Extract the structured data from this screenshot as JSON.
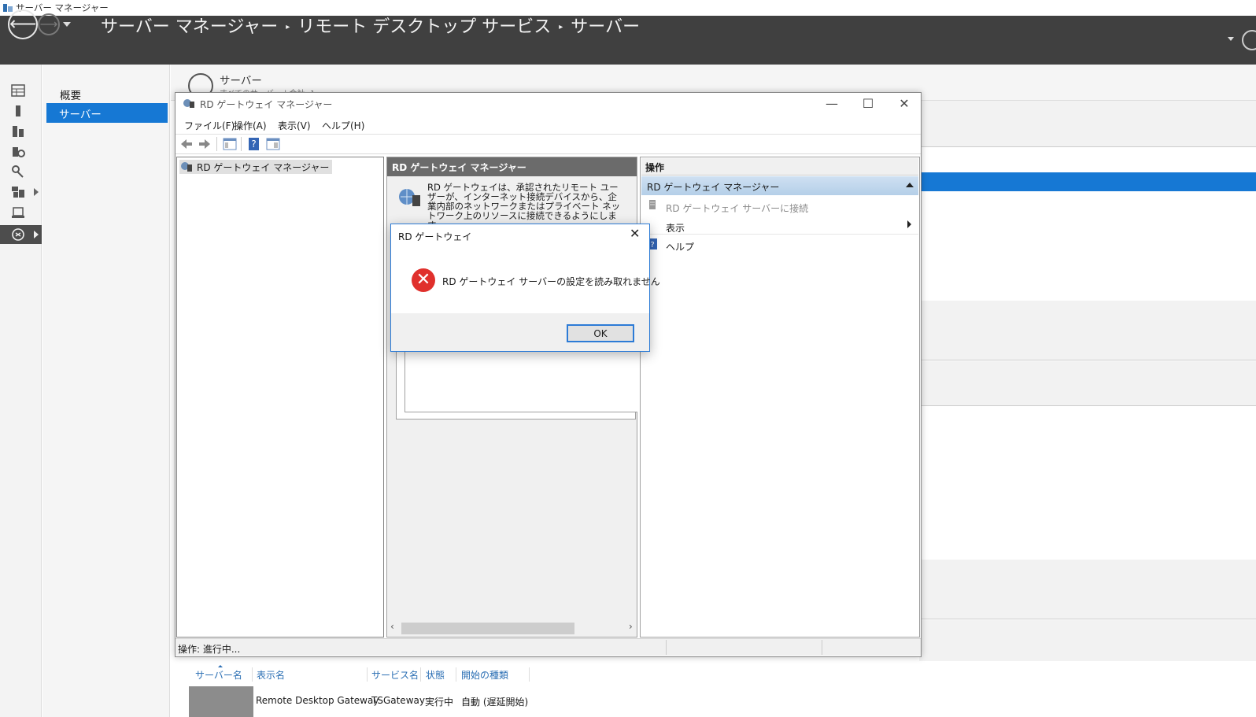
{
  "server_manager": {
    "window_title": "サーバー マネージャー",
    "breadcrumb": [
      "サーバー マネージャー",
      "リモート デスクトップ サービス",
      "サーバー"
    ],
    "breadcrumb_sep": "▸",
    "nav": {
      "overview": "概要",
      "servers": "サーバー"
    },
    "content": {
      "title": "サーバー",
      "subtitle": "すべてのサーバー | 合計: 1"
    },
    "services_table": {
      "columns": [
        "サーバー名",
        "表示名",
        "サービス名",
        "状態",
        "開始の種類"
      ],
      "rows": [
        {
          "server_name": "",
          "display_name": "Remote Desktop Gateway",
          "service_name": "TSGateway",
          "status": "実行中",
          "startup_type": "自動 (遅延開始)"
        }
      ]
    }
  },
  "mmc": {
    "title": "RD ゲートウェイ マネージャー",
    "window_buttons": {
      "minimize": "—",
      "maximize": "☐",
      "close": "✕"
    },
    "menu": [
      "ファイル(F)",
      "操作(A)",
      "表示(V)",
      "ヘルプ(H)"
    ],
    "tree_root": "RD ゲートウェイ マネージャー",
    "middle": {
      "header": "RD ゲートウェイ マネージャー",
      "description": "RD ゲートウェイは、承認されたリモート ユーザーが、インターネット接続デバイスから、企業内部のネットワークまたはプライベート ネットワーク上のリソースに接続できるようにします。"
    },
    "actions": {
      "header": "操作",
      "section": "RD ゲートウェイ マネージャー",
      "items": [
        "RD ゲートウェイ サーバーに接続",
        "表示",
        "ヘルプ"
      ]
    },
    "status_text": "操作: 進行中..."
  },
  "dialog": {
    "title": "RD ゲートウェイ",
    "close": "✕",
    "icon": "error-icon",
    "message": "RD ゲートウェイ サーバーの設定を読み取れません",
    "ok_label": "OK"
  },
  "colors": {
    "header_bg": "#404040",
    "selection_blue": "#1678d4",
    "error_red": "#e0302c",
    "link_blue": "#2b6fb4"
  }
}
